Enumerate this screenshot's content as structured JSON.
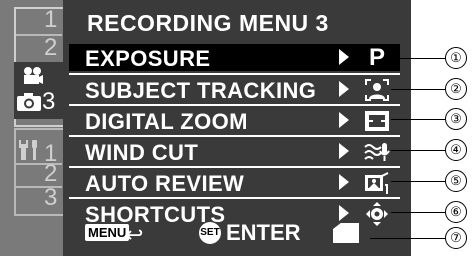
{
  "menu": {
    "title": "RECORDING MENU 3",
    "items": [
      {
        "label": "EXPOSURE",
        "value": "P",
        "icon": "program-mode-icon",
        "selected": true
      },
      {
        "label": "SUBJECT TRACKING",
        "value": "",
        "icon": "subject-tracking-icon",
        "selected": false
      },
      {
        "label": "DIGITAL ZOOM",
        "value": "",
        "icon": "digital-zoom-icon",
        "selected": false
      },
      {
        "label": "WIND CUT",
        "value": "",
        "icon": "wind-cut-icon",
        "selected": false
      },
      {
        "label": "AUTO REVIEW",
        "value": "",
        "icon": "auto-review-icon",
        "selected": false
      },
      {
        "label": "SHORTCUTS",
        "value": "",
        "icon": "shortcuts-icon",
        "selected": false
      }
    ]
  },
  "tabs": {
    "recording": [
      "1",
      "2",
      "3"
    ],
    "setup": [
      "1",
      "2",
      "3"
    ]
  },
  "footer": {
    "menu_key": "MENU",
    "set_key": "SET",
    "enter_label": "ENTER"
  },
  "callouts": [
    "①",
    "②",
    "③",
    "④",
    "⑤",
    "⑥",
    "⑦"
  ],
  "colors": {
    "panel": "#3a3a3a",
    "tabs": "#7a7a7a",
    "selected": "#000000",
    "text": "#ffffff"
  }
}
